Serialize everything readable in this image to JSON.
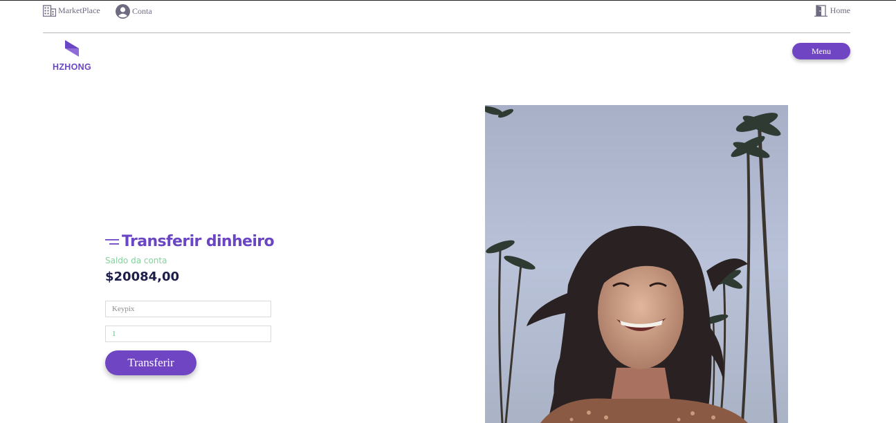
{
  "topbar": {
    "marketplace_label": "MarketPlace",
    "account_label": "Conta",
    "home_label": "Home"
  },
  "brand": {
    "logo_text": "HZHONG",
    "accent_color": "#6a45c4"
  },
  "menu": {
    "label": "Menu"
  },
  "transfer": {
    "title": "Transferir dinheiro",
    "balance_label": "Saldo da conta",
    "balance_value": "$20084,00",
    "keypix_placeholder": "Keypix",
    "amount_value": "1",
    "button_label": "Transferir"
  },
  "colors": {
    "primary": "#6f45c4",
    "balance_label": "#7fd49a",
    "balance_value": "#1d1e4a",
    "top_link": "#6f6a80"
  },
  "icons": {
    "marketplace": "building-icon",
    "account": "user-circle-icon",
    "home": "door-icon",
    "title": "lines-icon"
  }
}
